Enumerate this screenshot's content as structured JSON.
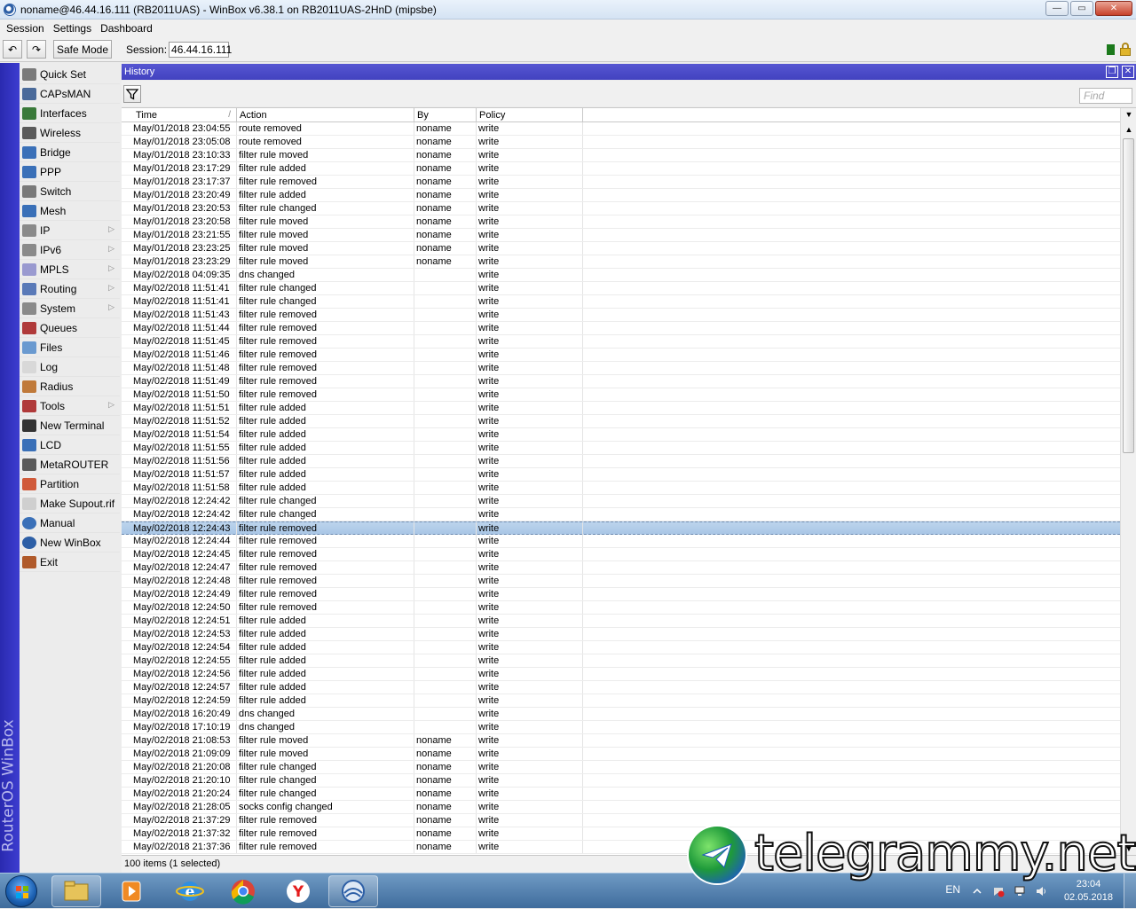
{
  "window": {
    "title": "noname@46.44.16.111 (RB2011UAS) - WinBox v6.38.1 on RB2011UAS-2HnD (mipsbe)",
    "minimize": "—",
    "maximize": "▭",
    "close": "✕"
  },
  "menu": [
    "Session",
    "Settings",
    "Dashboard"
  ],
  "toolbar": {
    "undo": "↶",
    "redo": "↷",
    "safe_mode": "Safe Mode",
    "session_label": "Session:",
    "session_value": "46.44.16.111",
    "status_color": "#1c7a1c"
  },
  "brand": "RouterOS WinBox",
  "sidebar": [
    {
      "label": "Quick Set",
      "icon": "wand-icon",
      "submenu": false
    },
    {
      "label": "CAPsMAN",
      "icon": "antenna-icon",
      "submenu": false
    },
    {
      "label": "Interfaces",
      "icon": "interfaces-icon",
      "submenu": false
    },
    {
      "label": "Wireless",
      "icon": "wireless-icon",
      "submenu": false
    },
    {
      "label": "Bridge",
      "icon": "bridge-icon",
      "submenu": false
    },
    {
      "label": "PPP",
      "icon": "ppp-icon",
      "submenu": false
    },
    {
      "label": "Switch",
      "icon": "switch-icon",
      "submenu": false
    },
    {
      "label": "Mesh",
      "icon": "mesh-icon",
      "submenu": false
    },
    {
      "label": "IP",
      "icon": "ip-icon",
      "submenu": true
    },
    {
      "label": "IPv6",
      "icon": "ipv6-icon",
      "submenu": true
    },
    {
      "label": "MPLS",
      "icon": "mpls-icon",
      "submenu": true
    },
    {
      "label": "Routing",
      "icon": "routing-icon",
      "submenu": true
    },
    {
      "label": "System",
      "icon": "gear-icon",
      "submenu": true
    },
    {
      "label": "Queues",
      "icon": "queues-icon",
      "submenu": false
    },
    {
      "label": "Files",
      "icon": "folder-icon",
      "submenu": false
    },
    {
      "label": "Log",
      "icon": "log-icon",
      "submenu": false
    },
    {
      "label": "Radius",
      "icon": "radius-icon",
      "submenu": false
    },
    {
      "label": "Tools",
      "icon": "tools-icon",
      "submenu": true
    },
    {
      "label": "New Terminal",
      "icon": "terminal-icon",
      "submenu": false
    },
    {
      "label": "LCD",
      "icon": "lcd-icon",
      "submenu": false
    },
    {
      "label": "MetaROUTER",
      "icon": "metarouter-icon",
      "submenu": false
    },
    {
      "label": "Partition",
      "icon": "partition-icon",
      "submenu": false
    },
    {
      "label": "Make Supout.rif",
      "icon": "supout-icon",
      "submenu": false
    },
    {
      "label": "Manual",
      "icon": "help-icon",
      "submenu": false
    },
    {
      "label": "New WinBox",
      "icon": "winbox-icon",
      "submenu": false
    },
    {
      "label": "Exit",
      "icon": "exit-icon",
      "submenu": false
    }
  ],
  "history": {
    "title": "History",
    "restore_btn": "❐",
    "close_btn": "✕",
    "find_placeholder": "Find",
    "columns": [
      "Time",
      "Action",
      "By",
      "Policy"
    ],
    "sort_mark": "/",
    "status": "100 items (1 selected)",
    "rows": [
      {
        "time": "May/01/2018 23:04:55",
        "action": "route removed",
        "by": "noname",
        "policy": "write"
      },
      {
        "time": "May/01/2018 23:05:08",
        "action": "route removed",
        "by": "noname",
        "policy": "write"
      },
      {
        "time": "May/01/2018 23:10:33",
        "action": "filter rule moved",
        "by": "noname",
        "policy": "write"
      },
      {
        "time": "May/01/2018 23:17:29",
        "action": "filter rule added",
        "by": "noname",
        "policy": "write"
      },
      {
        "time": "May/01/2018 23:17:37",
        "action": "filter rule removed",
        "by": "noname",
        "policy": "write"
      },
      {
        "time": "May/01/2018 23:20:49",
        "action": "filter rule added",
        "by": "noname",
        "policy": "write"
      },
      {
        "time": "May/01/2018 23:20:53",
        "action": "filter rule changed",
        "by": "noname",
        "policy": "write"
      },
      {
        "time": "May/01/2018 23:20:58",
        "action": "filter rule moved",
        "by": "noname",
        "policy": "write"
      },
      {
        "time": "May/01/2018 23:21:55",
        "action": "filter rule moved",
        "by": "noname",
        "policy": "write"
      },
      {
        "time": "May/01/2018 23:23:25",
        "action": "filter rule moved",
        "by": "noname",
        "policy": "write"
      },
      {
        "time": "May/01/2018 23:23:29",
        "action": "filter rule moved",
        "by": "noname",
        "policy": "write"
      },
      {
        "time": "May/02/2018 04:09:35",
        "action": "dns changed",
        "by": "",
        "policy": "write"
      },
      {
        "time": "May/02/2018 11:51:41",
        "action": "filter rule changed",
        "by": "",
        "policy": "write"
      },
      {
        "time": "May/02/2018 11:51:41",
        "action": "filter rule changed",
        "by": "",
        "policy": "write"
      },
      {
        "time": "May/02/2018 11:51:43",
        "action": "filter rule removed",
        "by": "",
        "policy": "write"
      },
      {
        "time": "May/02/2018 11:51:44",
        "action": "filter rule removed",
        "by": "",
        "policy": "write"
      },
      {
        "time": "May/02/2018 11:51:45",
        "action": "filter rule removed",
        "by": "",
        "policy": "write"
      },
      {
        "time": "May/02/2018 11:51:46",
        "action": "filter rule removed",
        "by": "",
        "policy": "write"
      },
      {
        "time": "May/02/2018 11:51:48",
        "action": "filter rule removed",
        "by": "",
        "policy": "write"
      },
      {
        "time": "May/02/2018 11:51:49",
        "action": "filter rule removed",
        "by": "",
        "policy": "write"
      },
      {
        "time": "May/02/2018 11:51:50",
        "action": "filter rule removed",
        "by": "",
        "policy": "write"
      },
      {
        "time": "May/02/2018 11:51:51",
        "action": "filter rule added",
        "by": "",
        "policy": "write"
      },
      {
        "time": "May/02/2018 11:51:52",
        "action": "filter rule added",
        "by": "",
        "policy": "write"
      },
      {
        "time": "May/02/2018 11:51:54",
        "action": "filter rule added",
        "by": "",
        "policy": "write"
      },
      {
        "time": "May/02/2018 11:51:55",
        "action": "filter rule added",
        "by": "",
        "policy": "write"
      },
      {
        "time": "May/02/2018 11:51:56",
        "action": "filter rule added",
        "by": "",
        "policy": "write"
      },
      {
        "time": "May/02/2018 11:51:57",
        "action": "filter rule added",
        "by": "",
        "policy": "write"
      },
      {
        "time": "May/02/2018 11:51:58",
        "action": "filter rule added",
        "by": "",
        "policy": "write"
      },
      {
        "time": "May/02/2018 12:24:42",
        "action": "filter rule changed",
        "by": "",
        "policy": "write"
      },
      {
        "time": "May/02/2018 12:24:42",
        "action": "filter rule changed",
        "by": "",
        "policy": "write"
      },
      {
        "time": "May/02/2018 12:24:43",
        "action": "filter rule removed",
        "by": "",
        "policy": "write",
        "selected": true
      },
      {
        "time": "May/02/2018 12:24:44",
        "action": "filter rule removed",
        "by": "",
        "policy": "write"
      },
      {
        "time": "May/02/2018 12:24:45",
        "action": "filter rule removed",
        "by": "",
        "policy": "write"
      },
      {
        "time": "May/02/2018 12:24:47",
        "action": "filter rule removed",
        "by": "",
        "policy": "write"
      },
      {
        "time": "May/02/2018 12:24:48",
        "action": "filter rule removed",
        "by": "",
        "policy": "write"
      },
      {
        "time": "May/02/2018 12:24:49",
        "action": "filter rule removed",
        "by": "",
        "policy": "write"
      },
      {
        "time": "May/02/2018 12:24:50",
        "action": "filter rule removed",
        "by": "",
        "policy": "write"
      },
      {
        "time": "May/02/2018 12:24:51",
        "action": "filter rule added",
        "by": "",
        "policy": "write"
      },
      {
        "time": "May/02/2018 12:24:53",
        "action": "filter rule added",
        "by": "",
        "policy": "write"
      },
      {
        "time": "May/02/2018 12:24:54",
        "action": "filter rule added",
        "by": "",
        "policy": "write"
      },
      {
        "time": "May/02/2018 12:24:55",
        "action": "filter rule added",
        "by": "",
        "policy": "write"
      },
      {
        "time": "May/02/2018 12:24:56",
        "action": "filter rule added",
        "by": "",
        "policy": "write"
      },
      {
        "time": "May/02/2018 12:24:57",
        "action": "filter rule added",
        "by": "",
        "policy": "write"
      },
      {
        "time": "May/02/2018 12:24:59",
        "action": "filter rule added",
        "by": "",
        "policy": "write"
      },
      {
        "time": "May/02/2018 16:20:49",
        "action": "dns changed",
        "by": "",
        "policy": "write"
      },
      {
        "time": "May/02/2018 17:10:19",
        "action": "dns changed",
        "by": "",
        "policy": "write"
      },
      {
        "time": "May/02/2018 21:08:53",
        "action": "filter rule moved",
        "by": "noname",
        "policy": "write"
      },
      {
        "time": "May/02/2018 21:09:09",
        "action": "filter rule moved",
        "by": "noname",
        "policy": "write"
      },
      {
        "time": "May/02/2018 21:20:08",
        "action": "filter rule changed",
        "by": "noname",
        "policy": "write"
      },
      {
        "time": "May/02/2018 21:20:10",
        "action": "filter rule changed",
        "by": "noname",
        "policy": "write"
      },
      {
        "time": "May/02/2018 21:20:24",
        "action": "filter rule changed",
        "by": "noname",
        "policy": "write"
      },
      {
        "time": "May/02/2018 21:28:05",
        "action": "socks config changed",
        "by": "noname",
        "policy": "write"
      },
      {
        "time": "May/02/2018 21:37:29",
        "action": "filter rule removed",
        "by": "noname",
        "policy": "write"
      },
      {
        "time": "May/02/2018 21:37:32",
        "action": "filter rule removed",
        "by": "noname",
        "policy": "write"
      },
      {
        "time": "May/02/2018 21:37:36",
        "action": "filter rule removed",
        "by": "noname",
        "policy": "write"
      }
    ]
  },
  "taskbar": {
    "language": "EN",
    "time": "23:04",
    "date": "02.05.2018"
  },
  "watermark": "telegrammy.net"
}
